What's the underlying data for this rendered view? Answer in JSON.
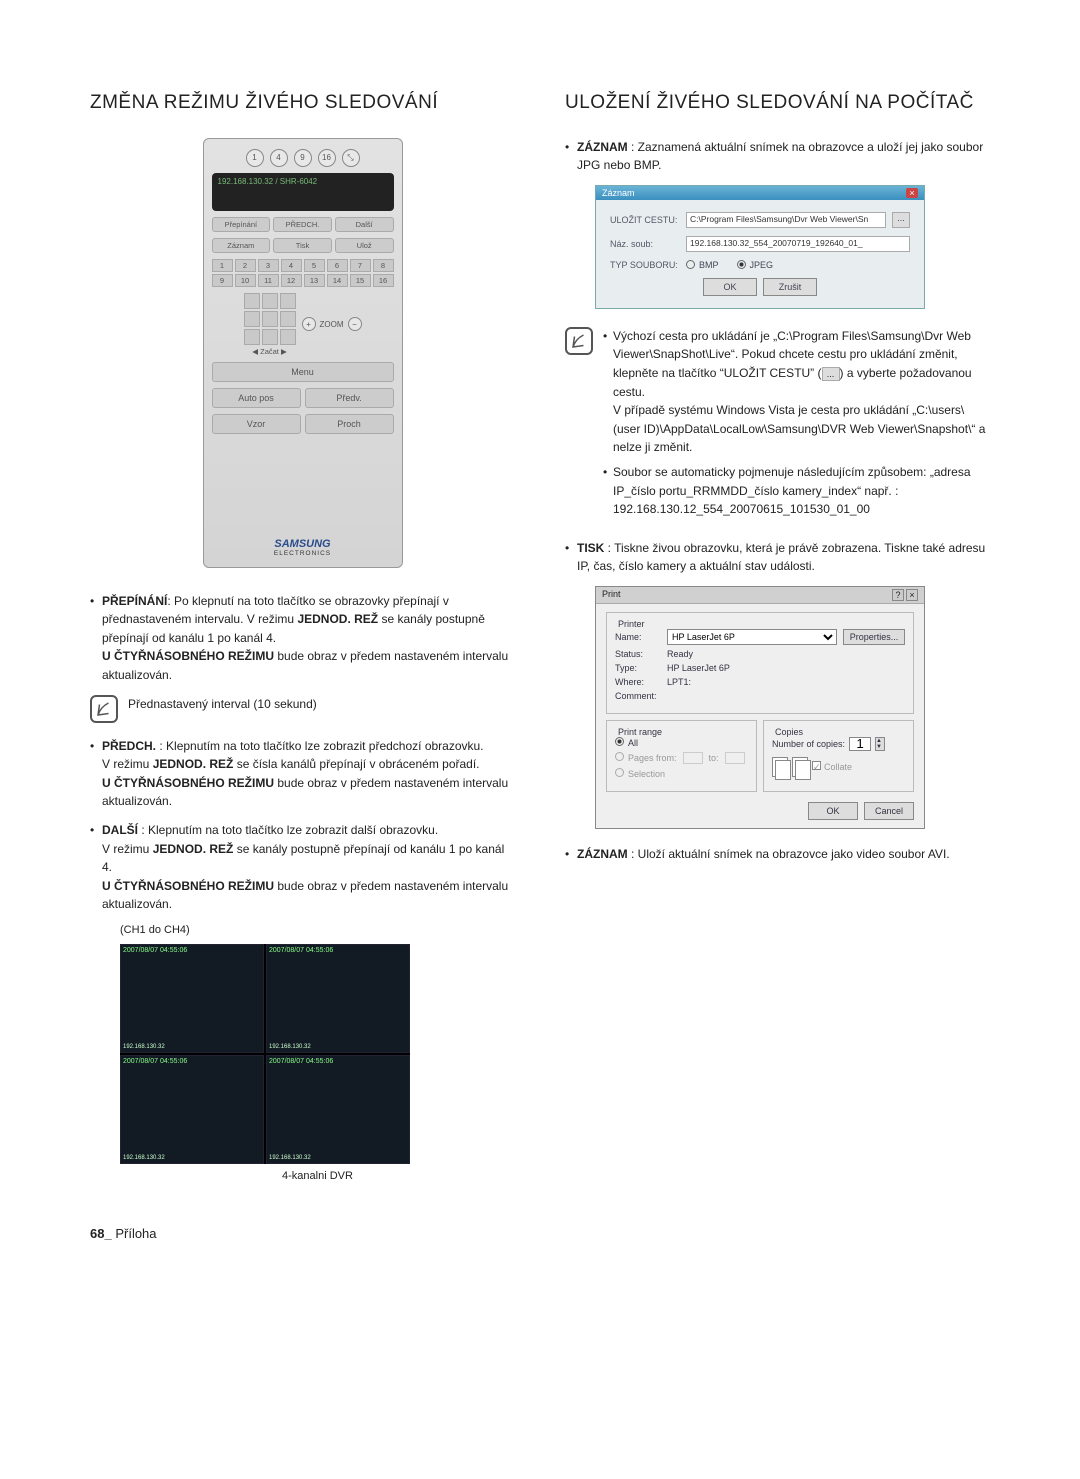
{
  "left": {
    "heading": "ZMĚNA REŽIMU ŽIVÉHO SLEDOVÁNÍ",
    "panel": {
      "modes": [
        "1",
        "4",
        "9",
        "16",
        "⤡"
      ],
      "screen_text": "192.168.130.32  /  SHR-6042",
      "tab1": "Přepínání",
      "tab2": "PŘEDCH.",
      "tab3": "Další",
      "row2a": "Záznam",
      "row2b": "Tisk",
      "row2c": "Ulož",
      "channels": [
        "1",
        "2",
        "3",
        "4",
        "5",
        "6",
        "7",
        "8",
        "9",
        "10",
        "11",
        "12",
        "13",
        "14",
        "15",
        "16"
      ],
      "ptz_center": "Začat",
      "zoom_label": "ZOOM",
      "menu": "Menu",
      "autopos": "Auto pos",
      "predv": "Předv.",
      "vzor": "Vzor",
      "proch": "Proch",
      "brand": "SAMSUNG",
      "brand_sub": "ELECTRONICS"
    },
    "bullets": {
      "prepinani_label": "PŘEPÍNÁNÍ",
      "prepinani_text": ": Po klepnutí na toto tlačítko se obrazovky přepínají v přednastaveném intervalu. V režimu ",
      "jednod": "JEDNOD. REŽ",
      "prepinani_text2": " se kanály postupně přepínají od kanálu 1 po kanál 4.",
      "ctyr": "U ČTYŘNÁSOBNÉHO REŽIMU",
      "ctyr_text": " bude obraz v předem nastaveném intervalu aktualizován.",
      "note": "Přednastavený interval (10 sekund)",
      "predch_label": "PŘEDCH.",
      "predch_text": " : Klepnutím na toto tlačítko lze zobrazit předchozí obrazovku.",
      "predch_text2": "V režimu ",
      "predch_text3": " se čísla kanálů přepínají v obráceném pořadí.",
      "dalsi_label": "DALŠÍ",
      "dalsi_text": " : Klepnutím na toto tlačítko lze zobrazit další obrazovku.",
      "dalsi_text2": "V režimu ",
      "dalsi_text3": " se kanály postupně přepínají od kanálu 1 po kanál 4.",
      "chcaption": "(CH1 do CH4)",
      "quad_ts": "2007/08/07 04:55:06",
      "quad_ip": "192.168.130.32",
      "kanalni": "4-kanalni DVR"
    }
  },
  "right": {
    "heading": "ULOŽENÍ ŽIVÉHO SLEDOVÁNÍ NA POČÍTAČ",
    "zaznam_label": "ZÁZNAM",
    "zaznam_text": " : Zaznamená aktuální snímek na obrazovce a uloží jej jako soubor JPG nebo BMP.",
    "save_dialog": {
      "title": "Záznam",
      "path_label": "ULOŽIT CESTU:",
      "path_value": "C:\\Program Files\\Samsung\\Dvr Web Viewer\\Sn",
      "name_label": "Náz. soub:",
      "name_value": "192.168.130.32_554_20070719_192640_01_",
      "type_label": "TYP SOUBORU:",
      "type_bmp": "BMP",
      "type_jpeg": "JPEG",
      "ok": "OK",
      "cancel": "Zrušit"
    },
    "note1_line1": "Výchozí cesta pro ukládání je „C:\\Program Files\\Samsung\\Dvr Web Viewer\\SnapShot\\Live“. Pokud chcete cestu pro ukládání změnit, klepněte na tlačítko “ULOŽIT CESTU” (",
    "note1_line1b": ") a vyberte požadovanou cestu.",
    "note1_line2": "V případě systému Windows Vista je cesta pro ukládání „C:\\users\\(user ID)\\AppData\\LocalLow\\Samsung\\DVR Web Viewer\\Snapshot\\“ a nelze ji změnit.",
    "note1_line3": "Soubor se automaticky pojmenuje následujícím způsobem: „adresa IP_číslo portu_RRMMDD_číslo kamery_index“ např. : 192.168.130.12_554_20070615_101530_01_00",
    "tisk_label": "TISK",
    "tisk_text": " : Tiskne živou obrazovku, která je právě zobrazena. Tiskne také adresu IP, čas, číslo kamery a aktuální stav události.",
    "print_dialog": {
      "title": "Print",
      "printer_legend": "Printer",
      "name_label": "Name:",
      "name_value": "HP LaserJet 6P",
      "properties": "Properties...",
      "status_label": "Status:",
      "status_value": "Ready",
      "type_label": "Type:",
      "type_value": "HP LaserJet 6P",
      "where_label": "Where:",
      "where_value": "LPT1:",
      "comment_label": "Comment:",
      "range_legend": "Print range",
      "range_all": "All",
      "range_pages": "Pages from:",
      "range_to": "to:",
      "range_sel": "Selection",
      "copies_legend": "Copies",
      "copies_label": "Number of copies:",
      "copies_value": "1",
      "collate": "Collate",
      "ok": "OK",
      "cancel": "Cancel"
    },
    "zaznam2_label": "ZÁZNAM",
    "zaznam2_text": " : Uloží aktuální snímek na obrazovce jako video soubor AVI."
  },
  "footer": {
    "page": "68_",
    "section": "Příloha"
  }
}
